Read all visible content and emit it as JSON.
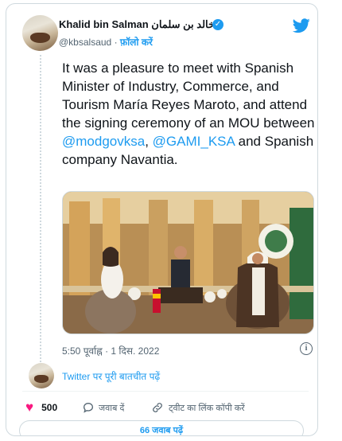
{
  "author": {
    "name": "Khalid bin Salman خالد بن سلمان",
    "handle": "@kbsalsaud",
    "separator": "·",
    "follow_label": "फ़ॉलो करें"
  },
  "tweet": {
    "text_before": "It was a pleasure to meet with Spanish Minister of Industry, Commerce, and Tourism María Reyes Maroto, and attend the signing ceremony of an MOU between ",
    "mention_1": "@modgovksa",
    "text_middle": ",",
    "mention_2": "@GAMI_KSA",
    "text_after": " and Spanish company Navantia.",
    "timestamp": "5:50 पूर्वाह्न · 1 दिस. 2022"
  },
  "conversation_link": "Twitter पर पूरी बातचीत पढ़ें",
  "actions": {
    "likes_count": "500",
    "reply_label": "जवाब दें",
    "copy_link_label": "ट्वीट का लिंक कॉपी करें"
  },
  "replies_button": "66 जवाब पढ़ें",
  "colors": {
    "accent": "#1d9bf0",
    "like": "#f91880",
    "secondary_text": "#536471"
  }
}
